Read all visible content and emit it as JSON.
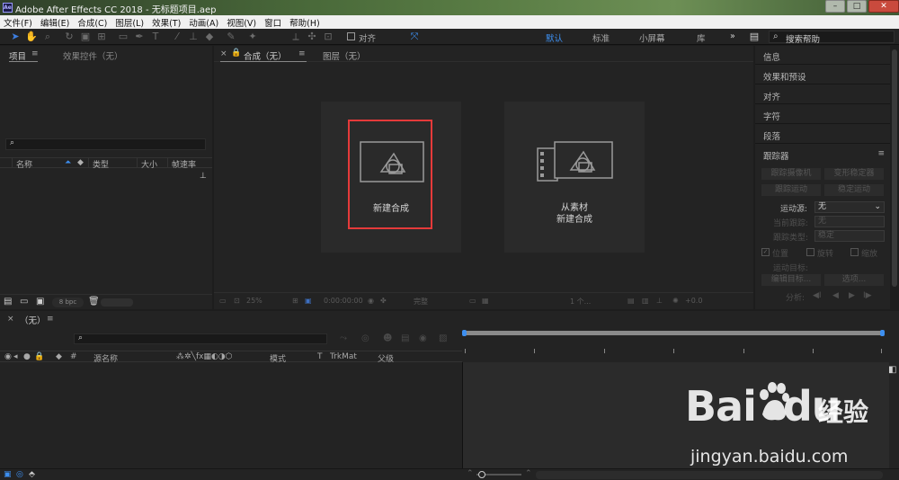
{
  "window": {
    "title": "Adobe After Effects CC 2018 - 无标题项目.aep",
    "app_logo": "Ae"
  },
  "menu": [
    "文件(F)",
    "编辑(E)",
    "合成(C)",
    "图层(L)",
    "效果(T)",
    "动画(A)",
    "视图(V)",
    "窗口",
    "帮助(H)"
  ],
  "toolbar": {
    "snap_label": "对齐",
    "workspaces": [
      "默认",
      "标准",
      "小屏幕",
      "库"
    ],
    "active_workspace": "默认",
    "more": "»",
    "search_placeholder": "搜索帮助"
  },
  "project": {
    "tab_project": "项目",
    "tab_effects": "效果控件（无）",
    "cols": {
      "name": "名称",
      "type": "类型",
      "size": "大小",
      "fps": "帧速率"
    },
    "bpc": "8 bpc"
  },
  "comp": {
    "tab_comp": "合成（无）",
    "tab_layer": "图层（无）",
    "new_comp_label": "新建合成",
    "from_footage_line1": "从素材",
    "from_footage_line2": "新建合成",
    "zoom": "25%",
    "timecode": "0:00:00:00",
    "resolution": "完整",
    "views": "1 个...",
    "exposure": "+0.0"
  },
  "right_panels": {
    "info": "信息",
    "effects_presets": "效果和预设",
    "align": "对齐",
    "character": "字符",
    "paragraph": "段落",
    "tracker": "跟踪器",
    "track_camera": "跟踪摄像机",
    "warp_stabilizer": "变形稳定器",
    "track_motion": "跟踪运动",
    "stabilize_motion": "稳定运动",
    "motion_source_label": "运动源:",
    "motion_source_value": "无",
    "current_track_label": "当前跟踪:",
    "current_track_value": "无",
    "track_type_label": "跟踪类型:",
    "track_type_value": "稳定",
    "position": "位置",
    "rotation": "旋转",
    "scale": "缩放",
    "motion_target": "运动目标:",
    "edit_target": "编辑目标...",
    "options": "选项...",
    "analyze": "分析:"
  },
  "timeline": {
    "tab_label": "（无）",
    "cols": {
      "source_name": "源名称",
      "mode": "模式",
      "t": "T",
      "trkmat": "TrkMat",
      "parent": "父级"
    }
  },
  "watermark": {
    "brand": "Bai",
    "brand_du": "du",
    "jingyan": "经验",
    "url": "jingyan.baidu.com"
  }
}
